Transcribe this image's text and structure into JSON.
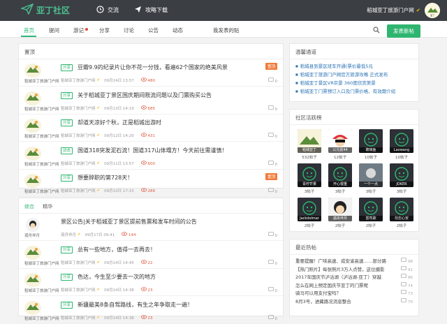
{
  "site": {
    "name": "亚丁社区"
  },
  "topnav": {
    "exchange": "交流",
    "guide": "攻略下载"
  },
  "user": {
    "name": "稻城亚丁旅游门户网"
  },
  "nav": {
    "items": [
      "首页",
      "提问",
      "游记",
      "分享",
      "讨论",
      "公告",
      "动态",
      "我发表的贴"
    ],
    "post_label": "发表新帖"
  },
  "pinned": {
    "header": "置顶",
    "posts": [
      {
        "tag": "分享",
        "title": "豆瓣9.9的纪录片让你不花一分钱，看遍62个国家的绝美风景",
        "author": "稻城亚丁旅游门户网",
        "date": "09月14日 13:57",
        "views": "480",
        "comments": "0",
        "badge": "置顶"
      },
      {
        "tag": "分享",
        "title": "关于稻城亚丁景区国庆期间限流问题以及门票购买公告",
        "author": "稻城亚丁旅游门户网",
        "date": "09月13日 14:19",
        "views": "685",
        "comments": "0",
        "badge": ""
      },
      {
        "tag": "分享",
        "title": "却道天凉好个秋，正是稻城出游时",
        "author": "稻城亚丁旅游门户网",
        "date": "09月12日 14:20",
        "views": "431",
        "comments": "0",
        "badge": ""
      },
      {
        "tag": "动态",
        "title": "国道318突发泥石流！国道317山体塌方！今天前往需谨慎！",
        "author": "稻城亚丁旅游门户网",
        "date": "09月11日 13:57",
        "views": "600",
        "comments": "0",
        "badge": ""
      },
      {
        "tag": "分享",
        "title": "想要辞职的第728天！",
        "author": "稻城亚丁旅游门户网",
        "date": "09月10日 17:15",
        "views": "289",
        "comments": "0",
        "badge": "置顶"
      }
    ]
  },
  "feed": {
    "tabs": [
      "综合",
      "精华"
    ],
    "posts": [
      {
        "tag": "",
        "title": "景区公告|关于稻城亚丁景区提前售票和发车时间的公告",
        "author": "孤舟伴月",
        "date": "09月17日 09:41",
        "views": "144",
        "comments": "0"
      },
      {
        "tag": "分享",
        "title": "总有一些地方，值得一去再去！",
        "author": "稻城亚丁旅游门户网",
        "date": "09月14日 14:45",
        "views": "22",
        "comments": "0"
      },
      {
        "tag": "分享",
        "title": "色达，今生至少要去一次的地方",
        "author": "稻城亚丁旅游门户网",
        "date": "09月14日 14:38",
        "views": "23",
        "comments": "0"
      },
      {
        "tag": "分享",
        "title": "新疆最美8条自驾路线，有生之年争取走一遍！",
        "author": "稻城亚丁旅游门户网",
        "date": "09月14日 14:38",
        "views": "23",
        "comments": "0"
      }
    ]
  },
  "notice": {
    "header": "温馨通道",
    "items": [
      "稻城县到景区班车开通(票价最低5元",
      "稻城亚丁旅游门户网官方旅游攻略 正式发布",
      "稻城亚丁景区VR实景 360度欣赏美景",
      "稻城亚丁门票预订入口及门票价格、有效期介绍"
    ]
  },
  "ranking": {
    "header": "社区活跃榜",
    "users": [
      {
        "name": "稻城亚丁",
        "count": "532帖子"
      },
      {
        "name": "公元前44",
        "count": "12帖子"
      },
      {
        "name": "玻璃鱼",
        "count": "10帖子"
      },
      {
        "name": "Laowang",
        "count": "10帖子"
      },
      {
        "name": "青柠芒果",
        "count": "3帖子"
      },
      {
        "name": "开心很重",
        "count": "3帖子"
      },
      {
        "name": "一个一点",
        "count": "3帖子"
      },
      {
        "name": "JOKER",
        "count": "3帖子"
      },
      {
        "name": "Jackdelmar",
        "count": "2帖子"
      },
      {
        "name": "孤舟伴月",
        "count": "2帖子"
      },
      {
        "name": "雷司歌",
        "count": "2帖子"
      },
      {
        "name": "勿忘心安",
        "count": "2帖子"
      }
    ]
  },
  "hot": {
    "header": "最近热帖",
    "items": [
      {
        "title": "重要提醒！广味高速、成安渝高速……部分路",
        "count": "98"
      },
      {
        "title": "【热门照片】每张照片3万人点赞，这位摄影",
        "count": "91"
      },
      {
        "title": "2017年国庆节泸沽湖（泸沽湖-亚丁）穿越",
        "count": "86"
      },
      {
        "title": "怎么在网上预定国庆节亚丁的门票呢",
        "count": "74"
      },
      {
        "title": "骑马可以用支付宝吗？",
        "count": "73"
      },
      {
        "title": "8月3号，进藏路况消息整合",
        "count": "70"
      }
    ]
  },
  "colors": {
    "accent": "#2eb56f",
    "topbar": "#3b3f44",
    "views": "#e05a3d",
    "link": "#2a72b5"
  }
}
